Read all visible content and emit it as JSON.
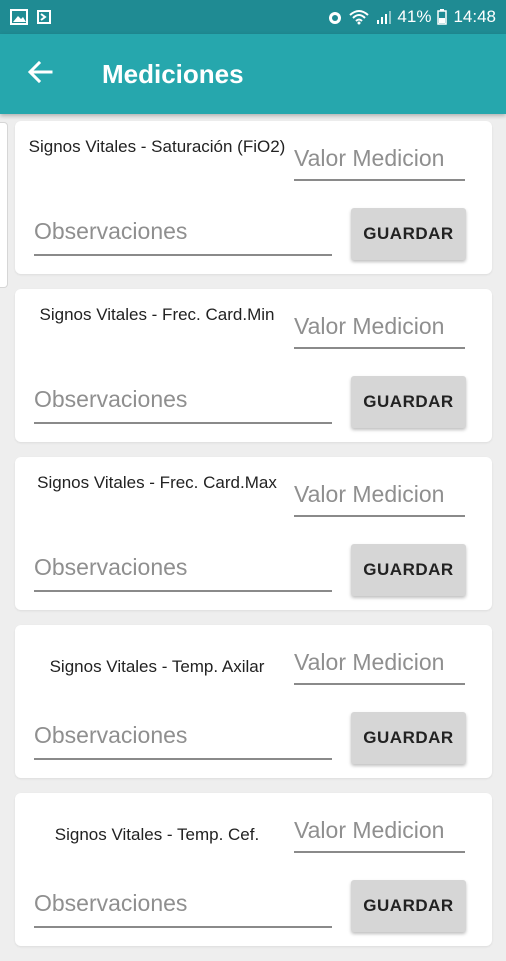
{
  "status_bar": {
    "battery": "41%",
    "time": "14:48",
    "icons": [
      "gallery-icon",
      "flag-icon",
      "alarm-icon",
      "wifi-icon",
      "signal-icon",
      "battery-icon"
    ]
  },
  "app_bar": {
    "title": "Mediciones",
    "back_icon": "arrow-left-icon"
  },
  "colors": {
    "status_bar": "#1f8b93",
    "app_bar": "#26a7ad",
    "background": "#eeeeee",
    "button": "#d6d6d6"
  },
  "cards": [
    {
      "label": "Signos Vitales - Saturación (FiO2)",
      "value_placeholder": "Valor Medicion",
      "obs_placeholder": "Observaciones",
      "button": "GUARDAR"
    },
    {
      "label": "Signos Vitales - Frec. Card.Min",
      "value_placeholder": "Valor Medicion",
      "obs_placeholder": "Observaciones",
      "button": "GUARDAR"
    },
    {
      "label": "Signos Vitales - Frec. Card.Max",
      "value_placeholder": "Valor Medicion",
      "obs_placeholder": "Observaciones",
      "button": "GUARDAR"
    },
    {
      "label": "Signos Vitales - Temp. Axilar",
      "value_placeholder": "Valor Medicion",
      "obs_placeholder": "Observaciones",
      "button": "GUARDAR"
    },
    {
      "label": "Signos Vitales - Temp. Cef.",
      "value_placeholder": "Valor Medicion",
      "obs_placeholder": "Observaciones",
      "button": "GUARDAR"
    }
  ]
}
